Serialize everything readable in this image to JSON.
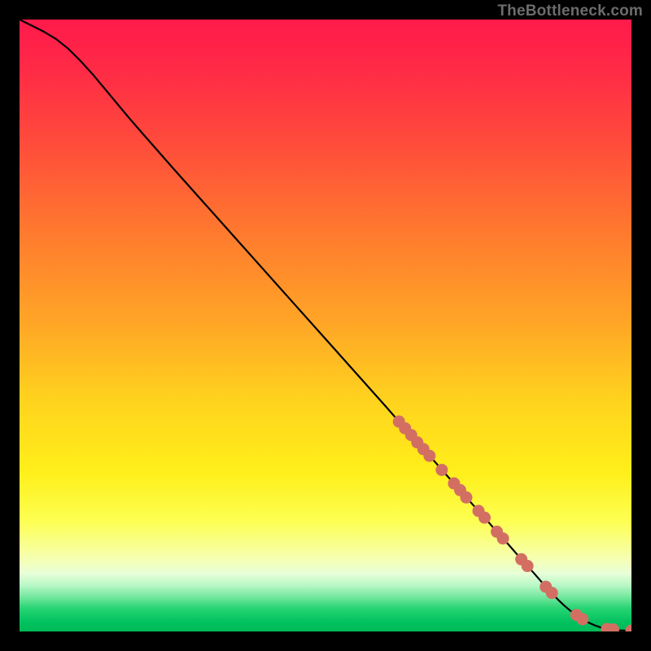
{
  "watermark": "TheBottleneck.com",
  "gradient_stops": [
    {
      "offset": 0.0,
      "color": "#ff1a4b"
    },
    {
      "offset": 0.08,
      "color": "#ff2a46"
    },
    {
      "offset": 0.2,
      "color": "#ff4b3b"
    },
    {
      "offset": 0.35,
      "color": "#ff7a2e"
    },
    {
      "offset": 0.5,
      "color": "#ffa726"
    },
    {
      "offset": 0.62,
      "color": "#ffd21e"
    },
    {
      "offset": 0.74,
      "color": "#ffef1a"
    },
    {
      "offset": 0.82,
      "color": "#fdff52"
    },
    {
      "offset": 0.88,
      "color": "#f6ffb0"
    },
    {
      "offset": 0.905,
      "color": "#e8ffd8"
    },
    {
      "offset": 0.925,
      "color": "#b7f7c6"
    },
    {
      "offset": 0.945,
      "color": "#6fe69b"
    },
    {
      "offset": 0.962,
      "color": "#28d473"
    },
    {
      "offset": 0.985,
      "color": "#00c25e"
    },
    {
      "offset": 1.0,
      "color": "#00ba57"
    }
  ],
  "chart_data": {
    "type": "line",
    "title": "",
    "xlabel": "",
    "ylabel": "",
    "xlim": [
      0,
      100
    ],
    "ylim": [
      0,
      100
    ],
    "series": [
      {
        "name": "curve",
        "x": [
          0,
          2,
          4,
          6,
          8,
          10,
          12,
          14,
          16,
          18,
          20,
          25,
          30,
          35,
          40,
          45,
          50,
          55,
          60,
          62,
          64,
          66,
          68,
          70,
          72,
          74,
          76,
          78,
          80,
          82,
          84,
          86,
          88,
          89,
          90,
          91,
          92,
          93,
          94,
          95,
          96,
          97,
          98,
          99,
          100
        ],
        "y": [
          100,
          99,
          98,
          96.8,
          95.2,
          93.2,
          91,
          88.6,
          86.2,
          83.8,
          81.5,
          75.8,
          70.2,
          64.6,
          59,
          53.4,
          47.8,
          42.2,
          36.6,
          34.3,
          32.1,
          29.8,
          27.6,
          25.3,
          23.1,
          20.8,
          18.6,
          16.3,
          14.1,
          11.8,
          9.6,
          7.3,
          5.2,
          4.25,
          3.4,
          2.65,
          2.0,
          1.45,
          1.0,
          0.65,
          0.4,
          0.26,
          0.18,
          0.15,
          0.15
        ]
      }
    ],
    "markers": {
      "name": "highlighted-points",
      "color": "#d36f62",
      "x": [
        62,
        63,
        64,
        65,
        66,
        67,
        69,
        71,
        72,
        73,
        75,
        76,
        78,
        79,
        82,
        83,
        86,
        87,
        91,
        92,
        96,
        97,
        100
      ],
      "y": [
        34.3,
        33.2,
        32.1,
        30.9,
        29.8,
        28.7,
        26.4,
        24.2,
        23.1,
        21.9,
        19.7,
        18.6,
        16.3,
        15.2,
        11.8,
        10.7,
        7.3,
        6.3,
        2.7,
        2.0,
        0.4,
        0.33,
        0.15
      ]
    }
  }
}
